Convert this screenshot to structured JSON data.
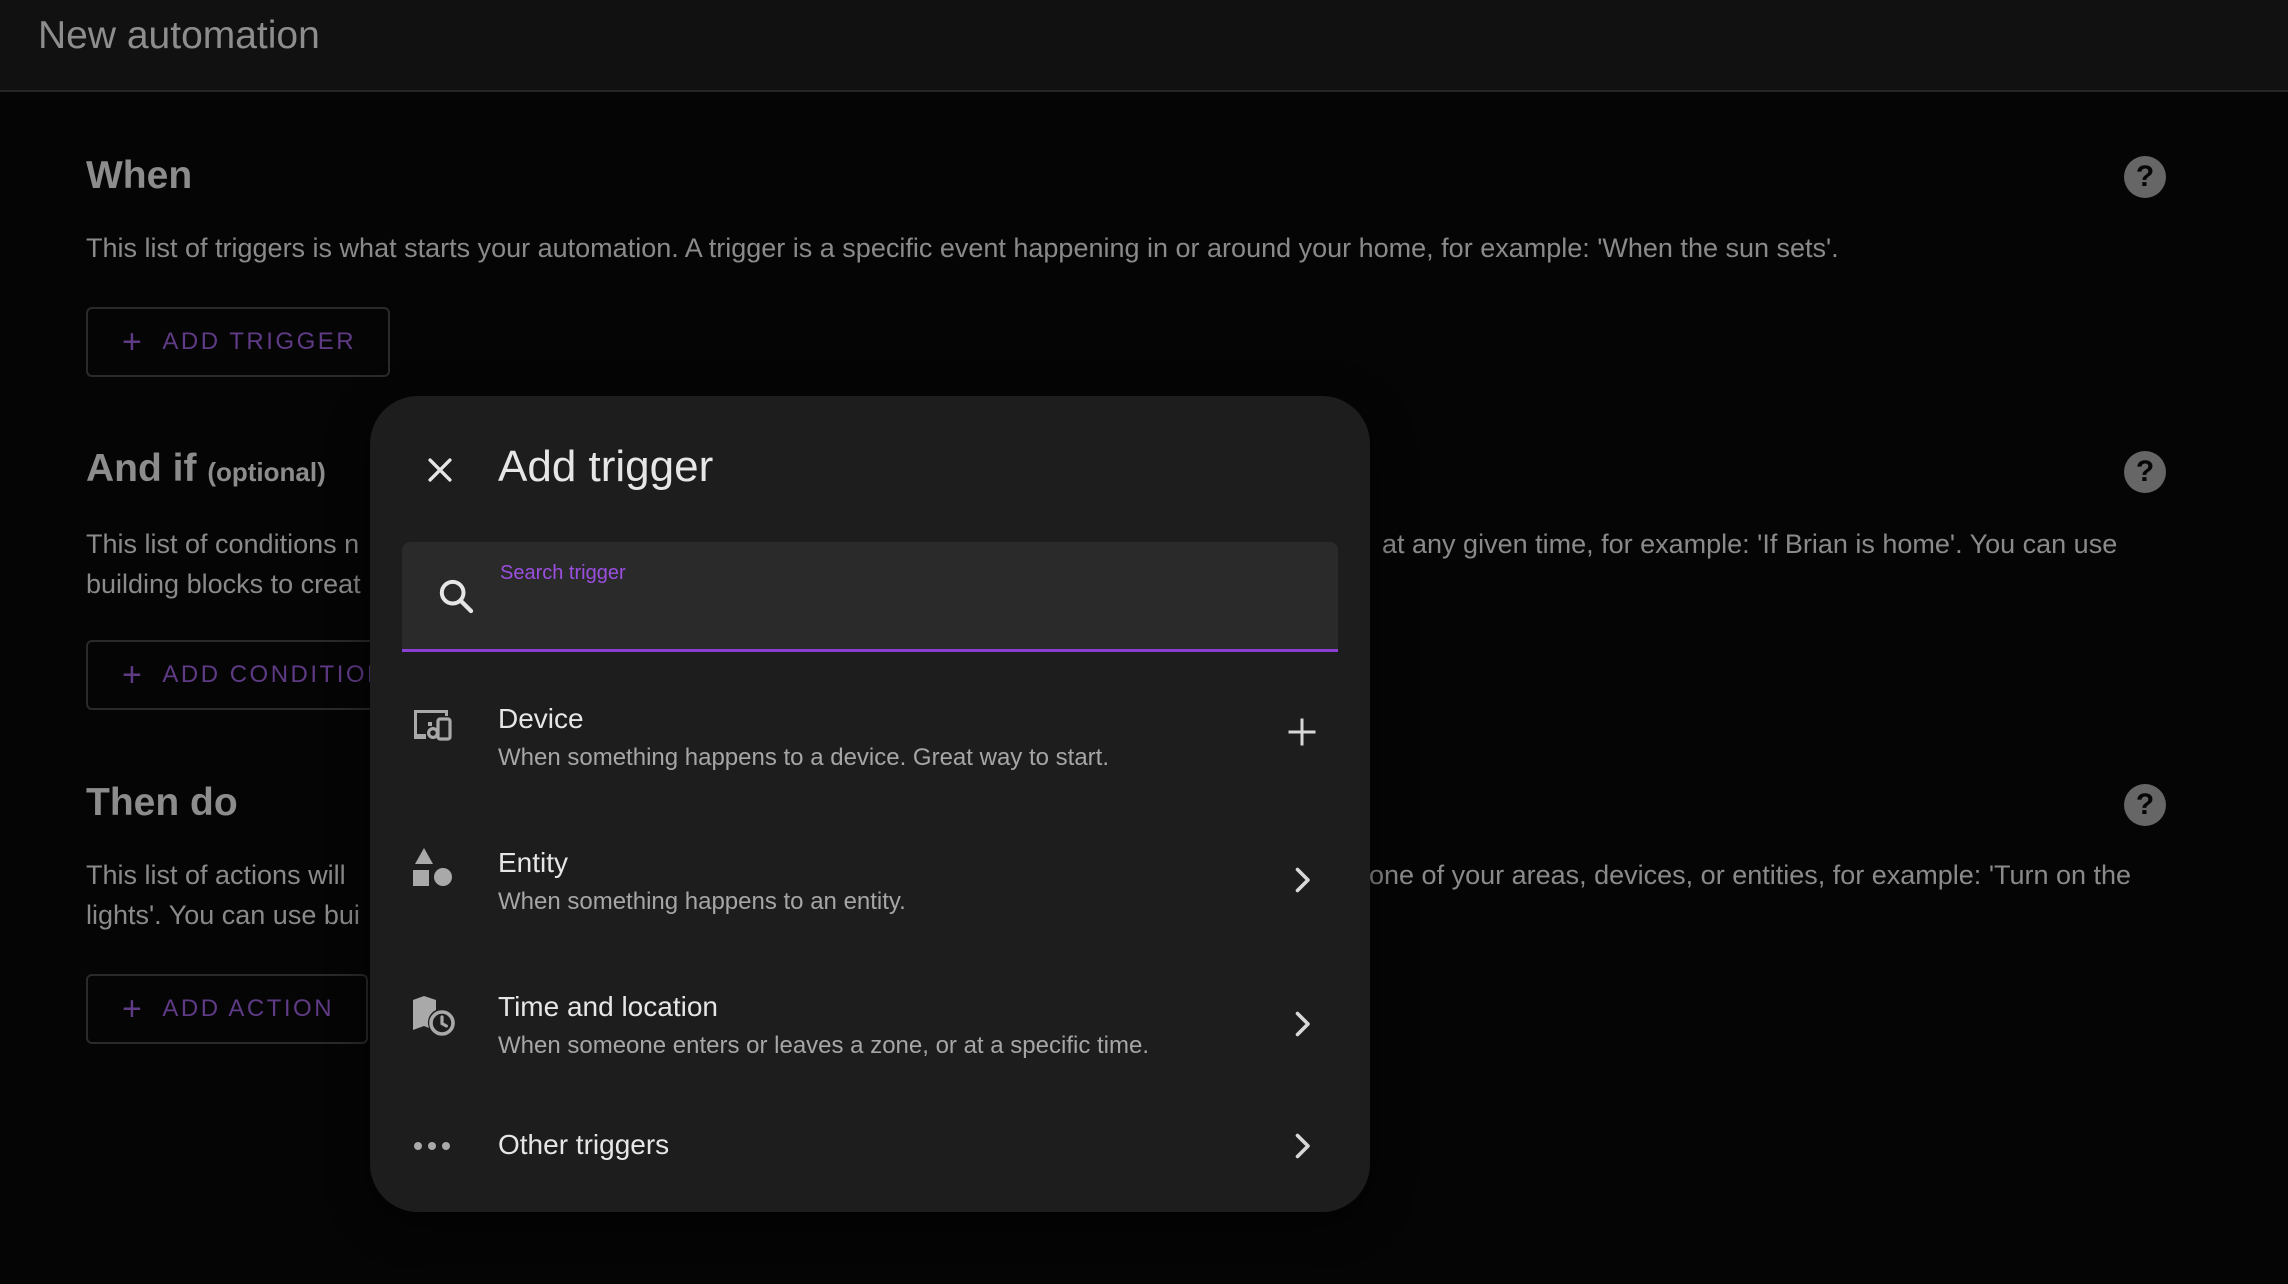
{
  "header": {
    "title": "New automation"
  },
  "sections": {
    "when": {
      "title": "When",
      "description": "This list of triggers is what starts your automation. A trigger is a specific event happening in or around your home, for example: 'When the sun sets'.",
      "button_label": "ADD TRIGGER"
    },
    "and_if": {
      "title": "And if",
      "optional": "(optional)",
      "description_left": "This list of conditions n",
      "description_right": "at any given time, for example: 'If Brian is home'. You can use",
      "description_line2": "building blocks to creat",
      "button_label": "ADD CONDITION"
    },
    "then_do": {
      "title": "Then do",
      "description_left": "This list of actions will",
      "description_right": "one of your areas, devices, or entities, for example: 'Turn on the",
      "description_line2": "lights'. You can use bui",
      "button_label": "ADD ACTION"
    }
  },
  "dialog": {
    "title": "Add trigger",
    "search": {
      "label": "Search trigger",
      "value": ""
    },
    "items": [
      {
        "title": "Device",
        "description": "When something happens to a device. Great way to start.",
        "icon": "device-icon",
        "trailing": "plus-icon"
      },
      {
        "title": "Entity",
        "description": "When something happens to an entity.",
        "icon": "shapes-icon",
        "trailing": "chevron-right-icon"
      },
      {
        "title": "Time and location",
        "description": "When someone enters or leaves a zone, or at a specific time.",
        "icon": "map-clock-icon",
        "trailing": "chevron-right-icon"
      },
      {
        "title": "Other triggers",
        "description": "",
        "icon": "dots-icon",
        "trailing": "chevron-right-icon"
      }
    ]
  },
  "colors": {
    "accent": "#8b3fd0",
    "button_text": "#5f3a85",
    "dialog_bg": "#1d1d1d",
    "page_bg": "#050505"
  }
}
